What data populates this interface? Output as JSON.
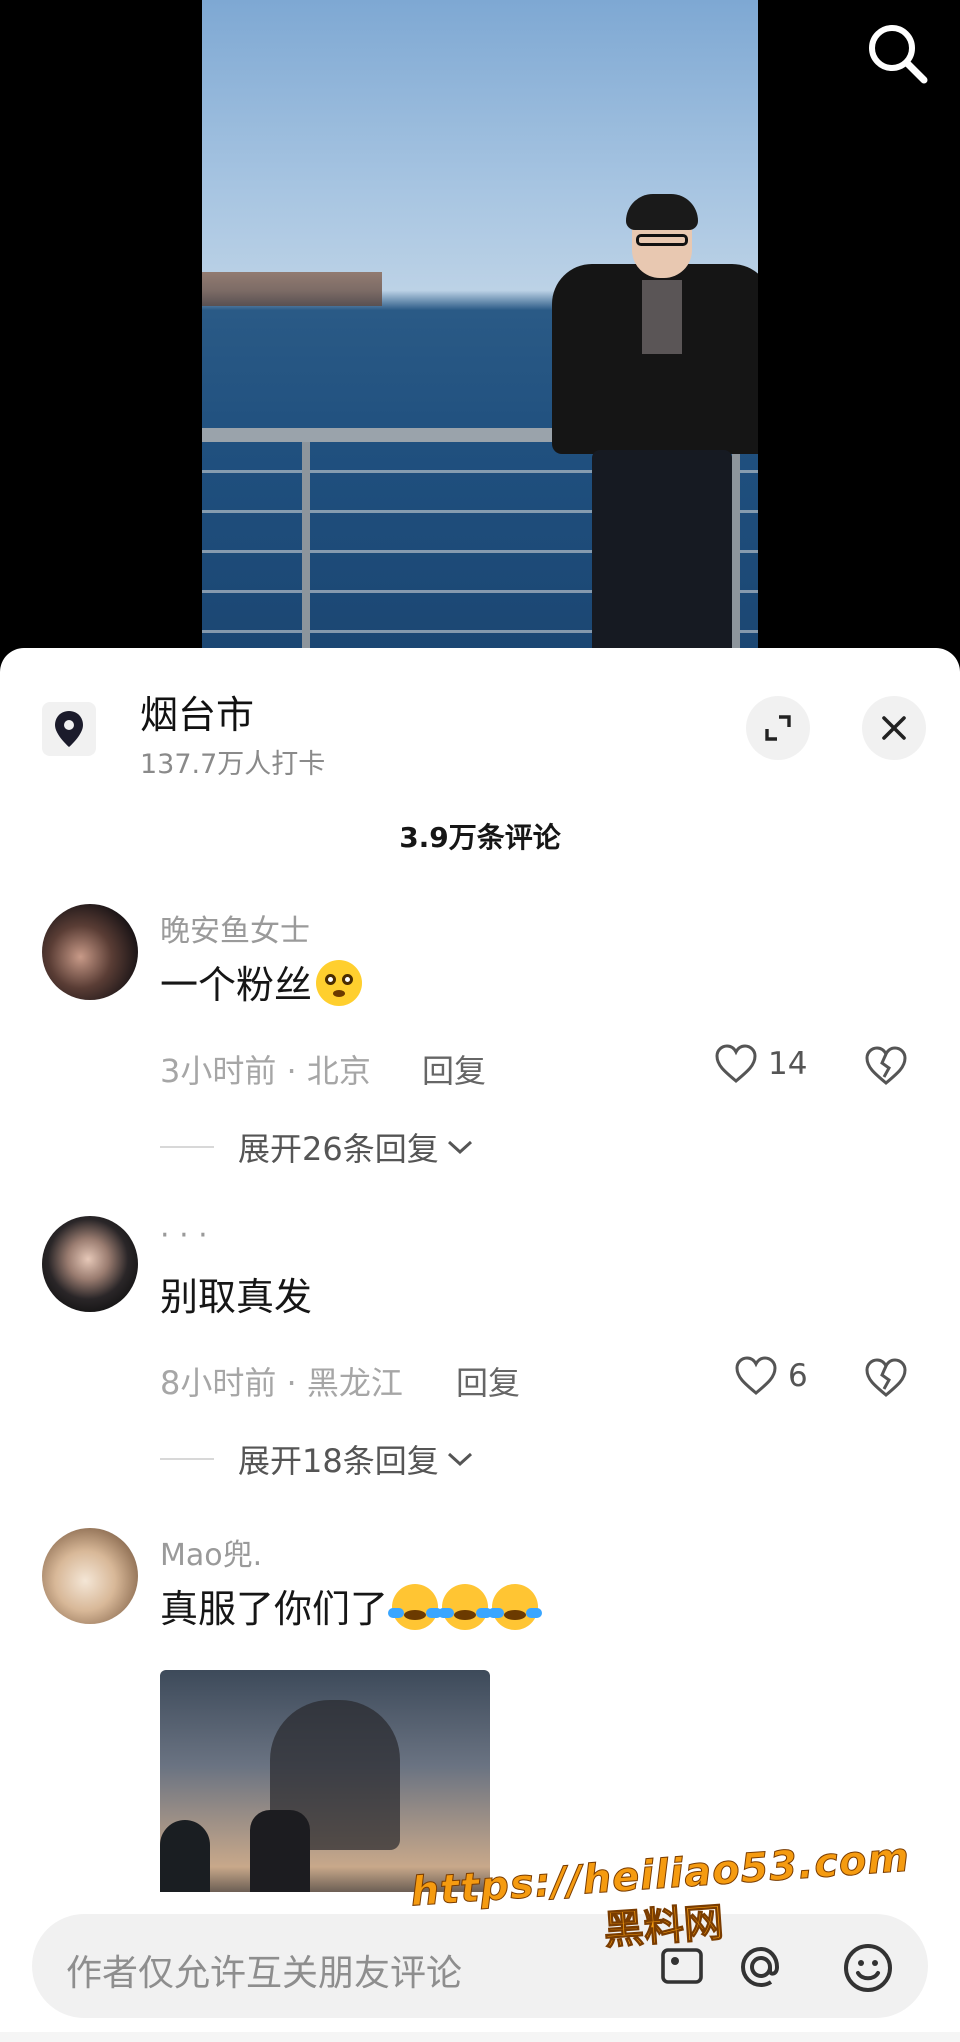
{
  "location": {
    "title": "烟台市",
    "subtitle": "137.7万人打卡"
  },
  "comments_header": {
    "count_label": "3.9万条评论"
  },
  "comments": [
    {
      "user": "晚安鱼女士",
      "text": "一个粉丝",
      "meta": "3小时前 · 北京",
      "reply_label": "回复",
      "likes": "14",
      "expand_label": "展开26条回复"
    },
    {
      "user": "· · ·",
      "text": "别取真发",
      "meta": "8小时前 · 黑龙江",
      "reply_label": "回复",
      "likes": "6",
      "expand_label": "展开18条回复"
    },
    {
      "user": "Mao兜.",
      "text": "真服了你们了"
    }
  ],
  "input": {
    "placeholder": "作者仅允许互关朋友评论"
  },
  "watermark": {
    "url": "https://heiliao53.com",
    "name": "黑料网"
  },
  "icons": {
    "search": "search-icon",
    "location": "location-pin-icon",
    "expand": "expand-icon",
    "close": "close-icon",
    "like": "heart-icon",
    "dislike": "broken-heart-icon",
    "chevron": "chevron-down-icon",
    "at": "at-icon",
    "emoji": "emoji-icon",
    "image": "image-icon"
  }
}
